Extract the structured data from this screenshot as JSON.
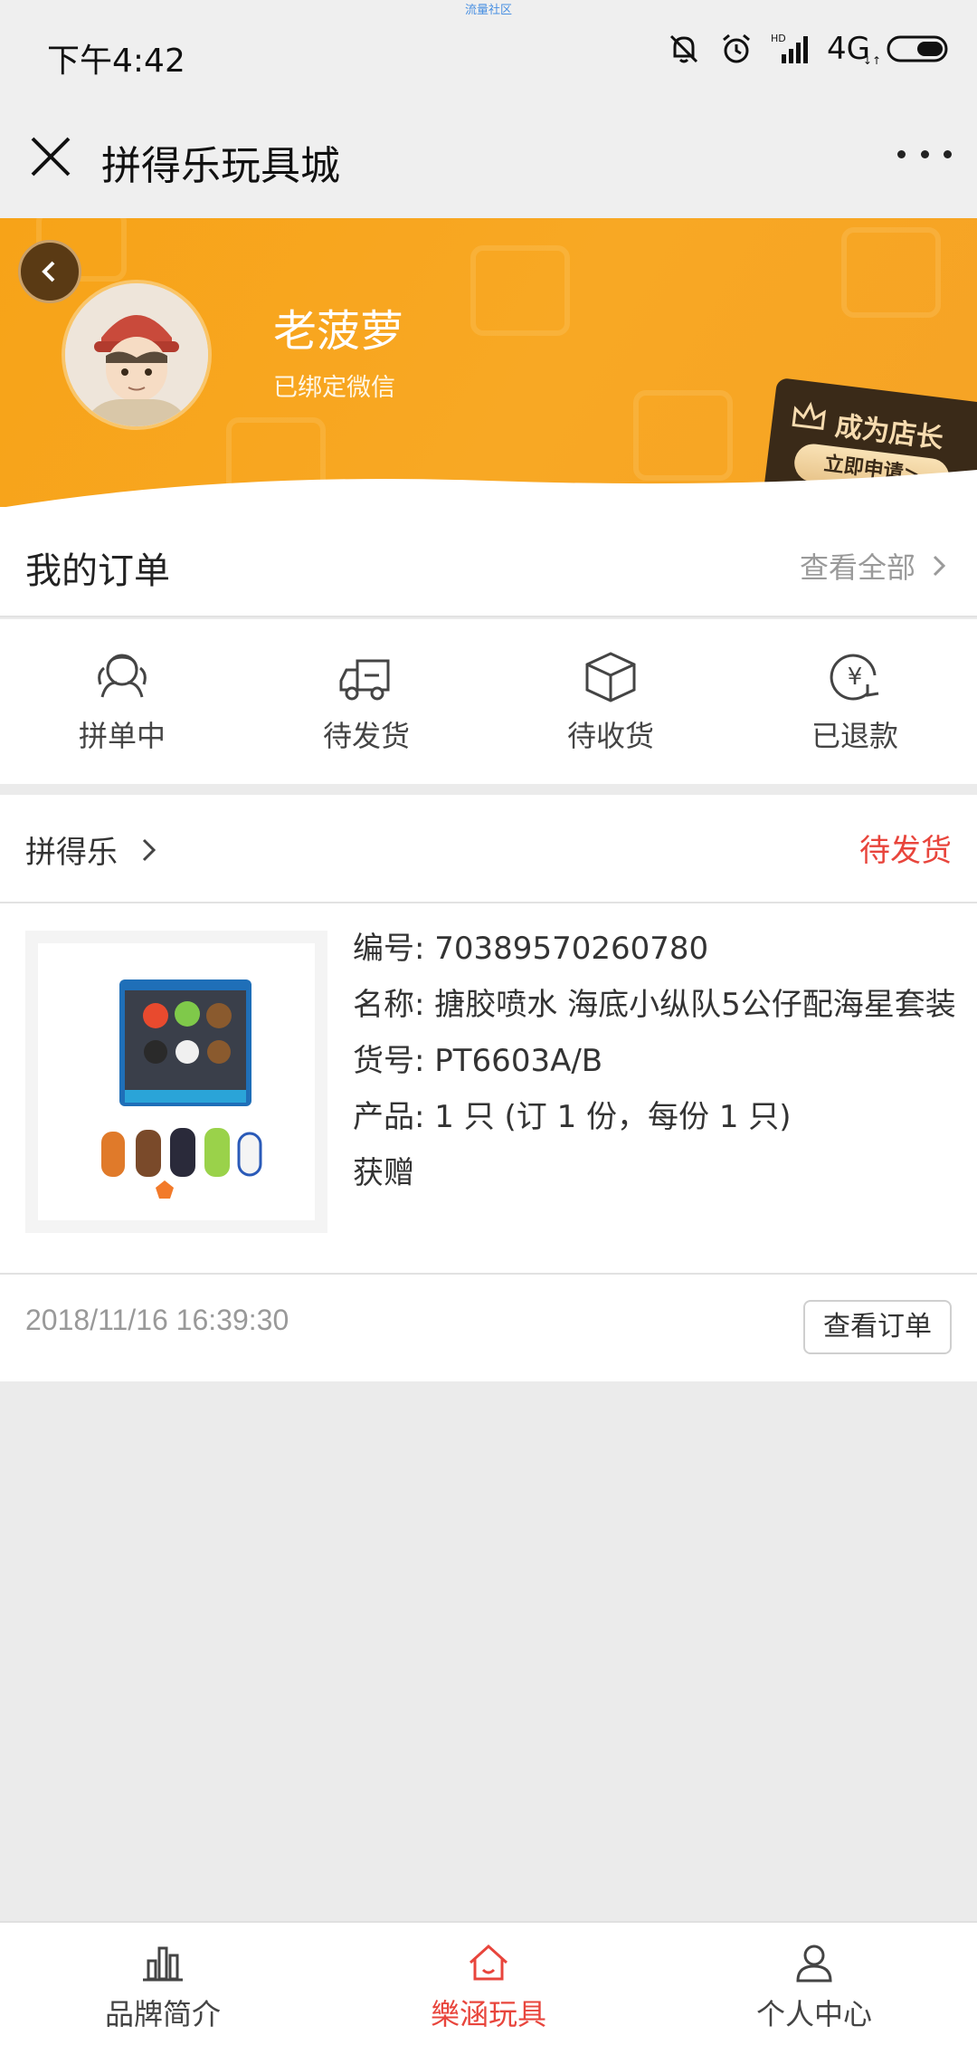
{
  "status_bar": {
    "top_label": "流量社区",
    "time": "下午4:42",
    "network": "4G",
    "network_small": "↓↑",
    "hd_label": "HD"
  },
  "title_bar": {
    "title": "拼得乐玩具城"
  },
  "profile": {
    "username": "老菠萝",
    "bind_status": "已绑定微信",
    "shop_promo_title": "成为店长",
    "shop_promo_button": "立即申请>"
  },
  "orders": {
    "title": "我的订单",
    "view_all": "查看全部",
    "tabs": [
      {
        "label": "拼单中",
        "icon": "group-icon"
      },
      {
        "label": "待发货",
        "icon": "truck-icon"
      },
      {
        "label": "待收货",
        "icon": "box-icon"
      },
      {
        "label": "已退款",
        "icon": "refund-icon"
      }
    ]
  },
  "order_card": {
    "shop": "拼得乐",
    "status": "待发货",
    "number_label": "编号:",
    "number": "70389570260780",
    "name_label": "名称:",
    "name": "搪胶喷水 海底小纵队5公仔配海星套装",
    "sku_label": "货号:",
    "sku": "PT6603A/B",
    "product_label": "产品:",
    "product": "1 只 (订 1 份，每份 1 只)",
    "gift": "获赠",
    "time": "2018/11/16 16:39:30",
    "view_button": "查看订单"
  },
  "bottom_nav": {
    "items": [
      {
        "label": "品牌简介",
        "icon": "chart-icon",
        "active": false
      },
      {
        "label": "樂涵玩具",
        "icon": "home-icon",
        "active": true
      },
      {
        "label": "个人中心",
        "icon": "user-icon",
        "active": false
      }
    ]
  },
  "colors": {
    "accent_red": "#e8453c",
    "banner_orange": "#f7a318"
  }
}
